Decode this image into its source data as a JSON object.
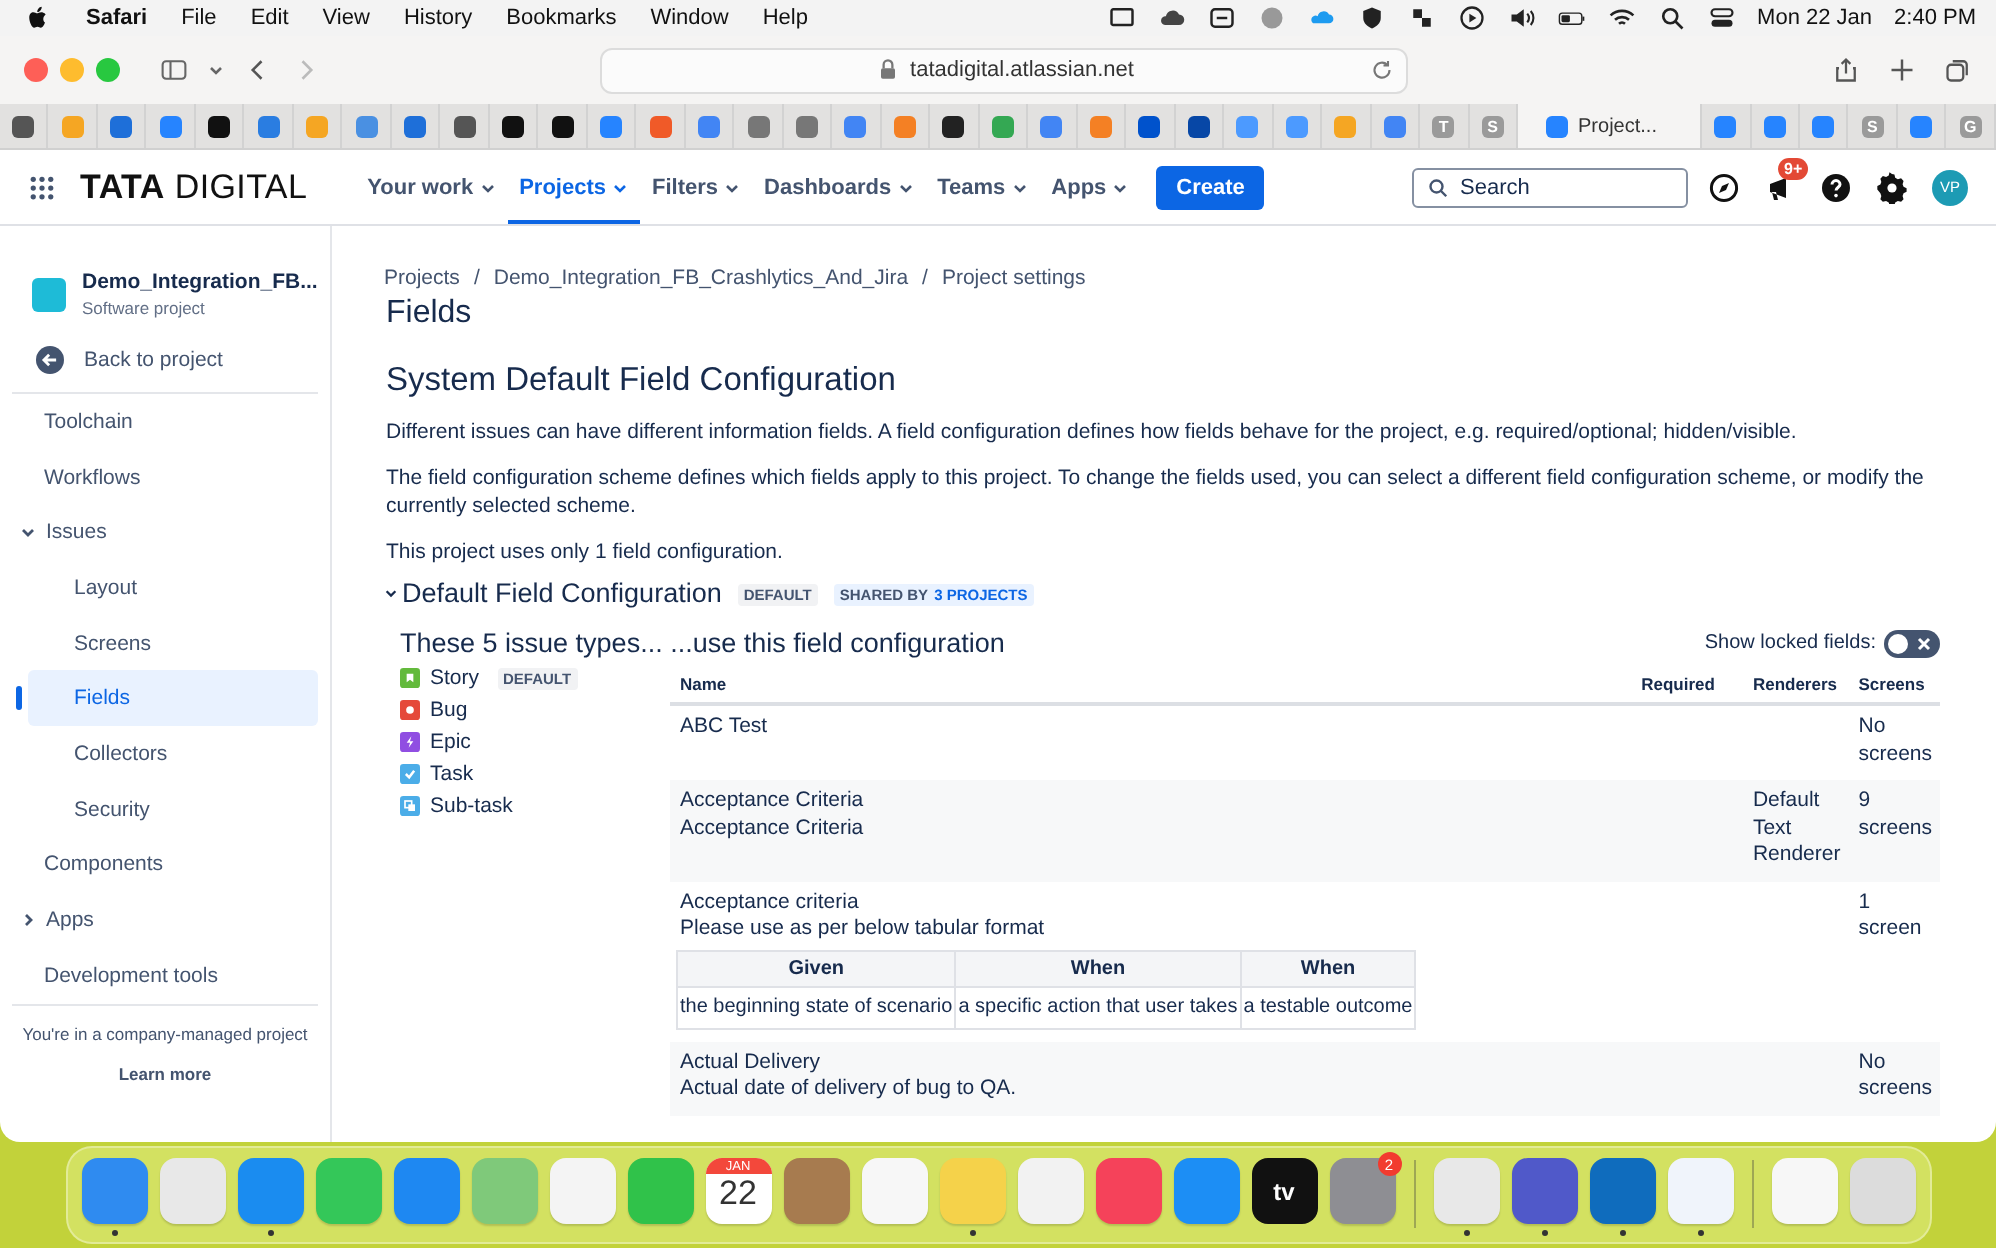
{
  "menubar": {
    "app": "Safari",
    "menus": [
      "File",
      "Edit",
      "View",
      "History",
      "Bookmarks",
      "Window",
      "Help"
    ],
    "date": "Mon 22 Jan",
    "time": "2:40 PM"
  },
  "browser": {
    "url": "tatadigital.atlassian.net",
    "tabs": [
      {
        "kind": "favicon",
        "color": "#555555",
        "selected": false
      },
      {
        "kind": "favicon",
        "color": "#f5a623",
        "selected": false
      },
      {
        "kind": "favicon",
        "color": "#1e6fd9",
        "selected": false
      },
      {
        "kind": "favicon",
        "color": "#2684ff",
        "selected": false
      },
      {
        "kind": "favicon",
        "color": "#111111",
        "selected": false
      },
      {
        "kind": "favicon",
        "color": "#2a7de1",
        "selected": false
      },
      {
        "kind": "favicon",
        "color": "#f5a623",
        "selected": false
      },
      {
        "kind": "favicon",
        "color": "#4a90e2",
        "selected": false
      },
      {
        "kind": "favicon",
        "color": "#1e6fd9",
        "selected": false
      },
      {
        "kind": "favicon",
        "color": "#555555",
        "selected": false
      },
      {
        "kind": "favicon",
        "color": "#111111",
        "selected": false
      },
      {
        "kind": "favicon",
        "color": "#111111",
        "selected": false
      },
      {
        "kind": "favicon",
        "color": "#2684ff",
        "selected": false
      },
      {
        "kind": "favicon",
        "color": "#f05a28",
        "selected": false
      },
      {
        "kind": "favicon",
        "color": "#4285f4",
        "selected": false
      },
      {
        "kind": "favicon",
        "color": "#777777",
        "selected": false
      },
      {
        "kind": "favicon",
        "color": "#777777",
        "selected": false
      },
      {
        "kind": "favicon",
        "color": "#4285f4",
        "selected": false
      },
      {
        "kind": "favicon",
        "color": "#f48024",
        "selected": false
      },
      {
        "kind": "favicon",
        "color": "#222222",
        "selected": false
      },
      {
        "kind": "favicon",
        "color": "#34a853",
        "selected": false
      },
      {
        "kind": "favicon",
        "color": "#4285f4",
        "selected": false
      },
      {
        "kind": "favicon",
        "color": "#f48024",
        "selected": false
      },
      {
        "kind": "favicon",
        "color": "#0052cc",
        "selected": false
      },
      {
        "kind": "favicon",
        "color": "#0747a6",
        "selected": false
      },
      {
        "kind": "favicon",
        "color": "#4c9aff",
        "selected": false
      },
      {
        "kind": "favicon",
        "color": "#4c9aff",
        "selected": false
      },
      {
        "kind": "favicon",
        "color": "#f5a623",
        "selected": false
      },
      {
        "kind": "favicon",
        "color": "#4285f4",
        "selected": false
      },
      {
        "kind": "letter",
        "letter": "T",
        "selected": false
      },
      {
        "kind": "letter",
        "letter": "S",
        "selected": false
      },
      {
        "kind": "favicon",
        "color": "#2684ff",
        "title": "Project...",
        "selected": true
      },
      {
        "kind": "favicon",
        "color": "#2684ff",
        "selected": false
      },
      {
        "kind": "favicon",
        "color": "#2684ff",
        "selected": false
      },
      {
        "kind": "favicon",
        "color": "#2684ff",
        "selected": false
      },
      {
        "kind": "letter",
        "letter": "S",
        "selected": false
      },
      {
        "kind": "favicon",
        "color": "#2684ff",
        "selected": false
      },
      {
        "kind": "letter",
        "letter": "G",
        "selected": false
      }
    ]
  },
  "jira_header": {
    "logo_bold": "TATA",
    "logo_light": "DIGITAL",
    "nav": [
      {
        "label": "Your work",
        "selected": false
      },
      {
        "label": "Projects",
        "selected": true
      },
      {
        "label": "Filters",
        "selected": false
      },
      {
        "label": "Dashboards",
        "selected": false
      },
      {
        "label": "Teams",
        "selected": false
      },
      {
        "label": "Apps",
        "selected": false
      }
    ],
    "create": "Create",
    "search": {
      "placeholder": "Search"
    },
    "notifications_badge": "9+",
    "avatar": "VP"
  },
  "sidebar": {
    "project_name": "Demo_Integration_FB...",
    "project_type": "Software project",
    "back": "Back to project",
    "items": [
      {
        "kind": "link",
        "label": "Toolchain",
        "selected": false
      },
      {
        "kind": "link",
        "label": "Workflows",
        "selected": false
      },
      {
        "kind": "group",
        "label": "Issues",
        "expanded": true,
        "selected": false,
        "children": [
          {
            "label": "Layout",
            "selected": false
          },
          {
            "label": "Screens",
            "selected": false
          },
          {
            "label": "Fields",
            "selected": true
          },
          {
            "label": "Collectors",
            "selected": false
          },
          {
            "label": "Security",
            "selected": false
          }
        ]
      },
      {
        "kind": "link",
        "label": "Components",
        "selected": false
      },
      {
        "kind": "group",
        "label": "Apps",
        "expanded": false,
        "selected": false
      },
      {
        "kind": "link",
        "label": "Development tools",
        "selected": false
      }
    ],
    "footer": "You're in a company-managed project",
    "learn_more": "Learn more"
  },
  "page": {
    "breadcrumbs": [
      "Projects",
      "Demo_Integration_FB_Crashlytics_And_Jira",
      "Project settings"
    ],
    "breadcrumb_separator": "/",
    "title": "Fields",
    "heading": "System Default Field Configuration",
    "paragraphs": [
      "Different issues can have different information fields. A field configuration defines how fields behave for the project, e.g. required/optional; hidden/visible.",
      "The field configuration scheme defines which fields apply to this project. To change the fields used, you can select a different field configuration scheme, or modify the currently selected scheme.",
      "This project uses only 1 field configuration."
    ],
    "config": {
      "name": "Default Field Configuration",
      "expanded": true,
      "default_label": "DEFAULT",
      "shared_label": "SHARED BY",
      "shared_link": "3 PROJECTS"
    },
    "issue_types": {
      "heading_left": "These 5 issue types...",
      "heading_right": "...use this field configuration",
      "items": [
        {
          "kind": "story",
          "name": "Story",
          "default_label": "DEFAULT"
        },
        {
          "kind": "bug",
          "name": "Bug"
        },
        {
          "kind": "epic",
          "name": "Epic"
        },
        {
          "kind": "task",
          "name": "Task"
        },
        {
          "kind": "subtask",
          "name": "Sub-task"
        }
      ]
    },
    "locked_toggle": {
      "label": "Show locked fields:",
      "on": false
    },
    "table": {
      "columns": [
        "Name",
        "Required",
        "Renderers",
        "Screens"
      ],
      "rows": [
        {
          "name": "ABC Test",
          "screens": "No screens"
        },
        {
          "name": "Acceptance Criteria",
          "description": "Acceptance Criteria",
          "renderer": "Default Text Renderer",
          "screens": "9 screens"
        },
        {
          "name": "Acceptance criteria",
          "description": "Please use as per below tabular format",
          "description_table": {
            "columns": [
              "Given",
              "When",
              "When"
            ],
            "rows": [
              [
                "the beginning state of scenario",
                "a specific action that user takes",
                "a testable outcome"
              ]
            ]
          },
          "screens": "1 screen"
        },
        {
          "name": "Actual Delivery",
          "description": "Actual date of delivery of bug to QA.",
          "screens": "No screens"
        }
      ]
    }
  },
  "dock": [
    {
      "kind": "app",
      "color": "#2f8bf0",
      "running": true
    },
    {
      "kind": "app",
      "color": "#e8e8e8",
      "running": false
    },
    {
      "kind": "app",
      "color": "#1a8cf0",
      "running": true
    },
    {
      "kind": "app",
      "color": "#34c759",
      "running": false
    },
    {
      "kind": "app",
      "color": "#1e88f2",
      "running": false
    },
    {
      "kind": "app",
      "color": "#7fc97a",
      "running": false
    },
    {
      "kind": "app",
      "color": "#f4f4f4",
      "running": false
    },
    {
      "kind": "app",
      "color": "#30c24a",
      "running": false
    },
    {
      "kind": "calendar",
      "month": "JAN",
      "day": "22",
      "running": false
    },
    {
      "kind": "app",
      "color": "#a77b4f",
      "running": false
    },
    {
      "kind": "app",
      "color": "#f7f7f7",
      "running": false
    },
    {
      "kind": "app",
      "color": "#f5d24a",
      "running": true
    },
    {
      "kind": "app",
      "color": "#f2f2f2",
      "running": false
    },
    {
      "kind": "app",
      "color": "#f5425a",
      "running": false
    },
    {
      "kind": "app",
      "color": "#1c8ef5",
      "running": false
    },
    {
      "kind": "tv",
      "label": "tv",
      "running": false
    },
    {
      "kind": "app",
      "color": "#8e8e93",
      "badge": "2",
      "running": false
    },
    {
      "kind": "divider"
    },
    {
      "kind": "app",
      "color": "#e8e8e8",
      "running": true
    },
    {
      "kind": "app",
      "color": "#5059c9",
      "running": true
    },
    {
      "kind": "app",
      "color": "#0f6cbd",
      "running": true
    },
    {
      "kind": "app",
      "color": "#f0f4fb",
      "running": true
    },
    {
      "kind": "divider"
    },
    {
      "kind": "app",
      "color": "#f7f7f7",
      "running": false
    },
    {
      "kind": "app",
      "color": "#dcdcdc",
      "running": false
    }
  ]
}
